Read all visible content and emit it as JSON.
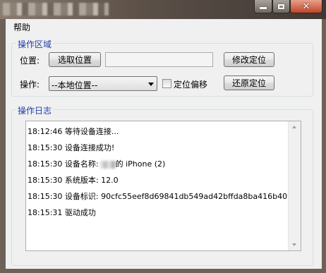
{
  "menu": {
    "help": "帮助"
  },
  "ops_group": {
    "legend": "操作区域",
    "position_label": "位置:",
    "select_position_button": "选取位置",
    "position_value": "",
    "modify_location_button": "修改定位",
    "operation_label": "操作:",
    "operation_select_value": "--本地位置--",
    "offset_checkbox_label": "定位偏移",
    "offset_checked": false,
    "restore_location_button": "还原定位"
  },
  "log_group": {
    "legend": "操作日志",
    "lines": [
      {
        "time": "18:12:46",
        "text": "等待设备连接..."
      },
      {
        "time": "18:15:30",
        "text": "设备连接成功!"
      },
      {
        "time": "18:15:30",
        "text_before": "设备名称:",
        "text_after": "的 iPhone (2)"
      },
      {
        "time": "18:15:30",
        "text": "系统版本: 12.0"
      },
      {
        "time": "18:15:30",
        "text": "设备标识: 90cfc55eef8d69841db549ad42bffda8ba416b40"
      },
      {
        "time": "18:15:31",
        "text": "驱动成功"
      }
    ]
  }
}
